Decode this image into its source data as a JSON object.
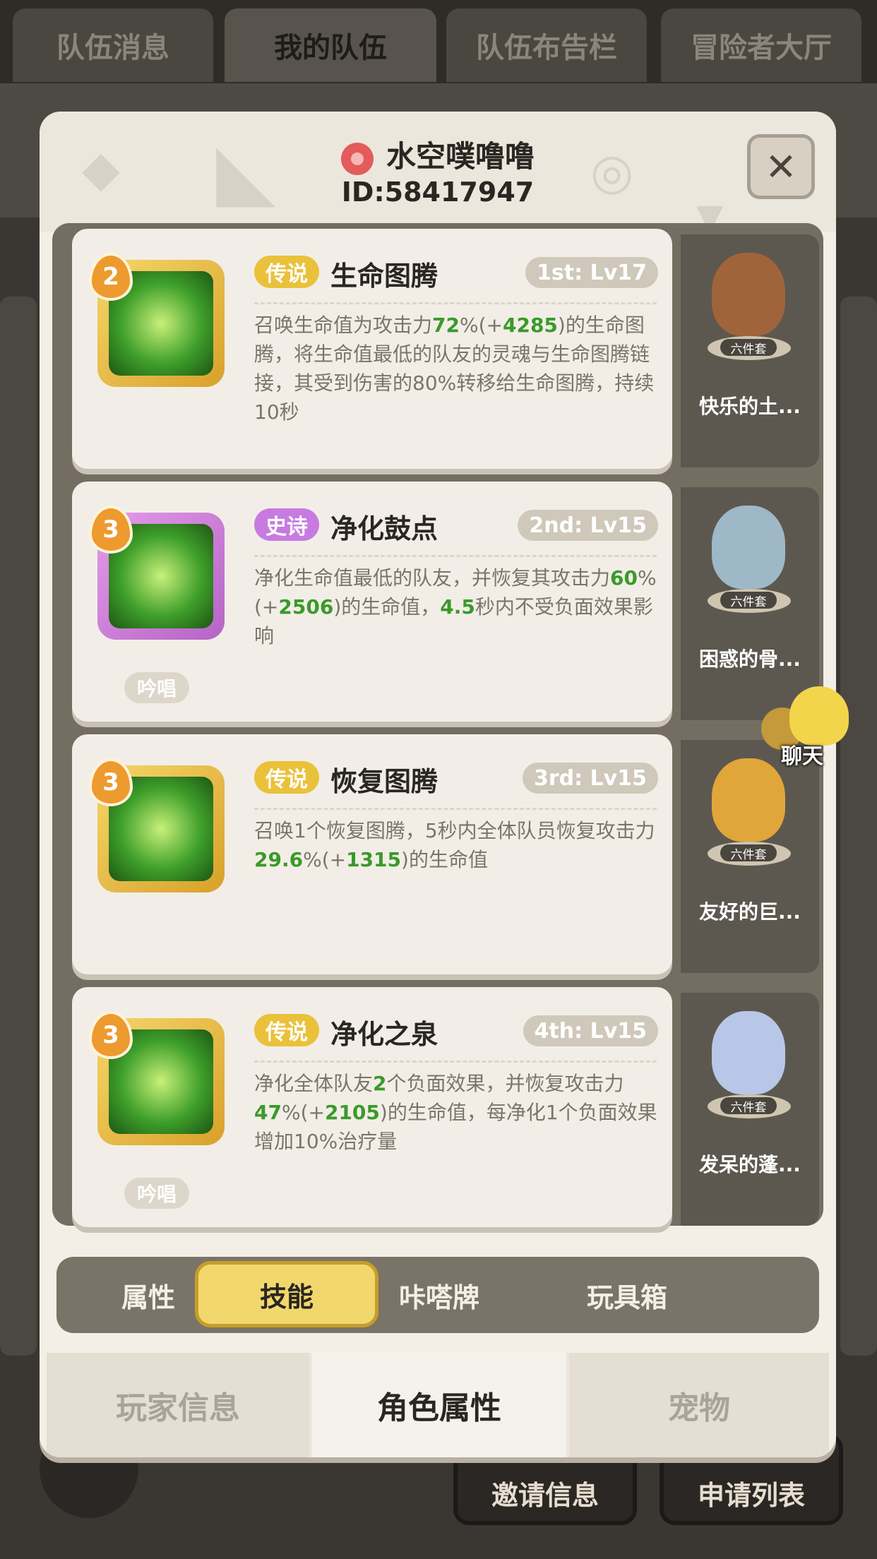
{
  "background": {
    "tabs": [
      "队伍消息",
      "我的队伍",
      "队伍布告栏",
      "冒险者大厅"
    ],
    "active_tab_index": 1,
    "bottom_buttons": [
      "邀请信息",
      "申请列表"
    ]
  },
  "player": {
    "name": "水空噗噜噜",
    "id_label": "ID:58417947"
  },
  "close_icon": "close-icon",
  "skills": [
    {
      "level_badge": "2",
      "rarity": "传说",
      "rarity_type": "legend",
      "name": "生命图腾",
      "rank": "1st: Lv17",
      "desc": [
        {
          "t": "召唤生命值为攻击力"
        },
        {
          "t": "72",
          "g": true
        },
        {
          "t": "%(+"
        },
        {
          "t": "4285",
          "g": true
        },
        {
          "t": ")的生命图腾，将生命值最低的队友的灵魂与生命图腾链接，其受到伤害的80%转移给生命图腾，持续10秒"
        }
      ],
      "chant": "",
      "pet_name": "快乐的土...",
      "pet_tag": "六件套",
      "pet_color": "#a0643a"
    },
    {
      "level_badge": "3",
      "rarity": "史诗",
      "rarity_type": "epic",
      "name": "净化鼓点",
      "rank": "2nd: Lv15",
      "desc": [
        {
          "t": "净化生命值最低的队友，并恢复其攻击力"
        },
        {
          "t": "60",
          "g": true
        },
        {
          "t": "%(+"
        },
        {
          "t": "2506",
          "g": true
        },
        {
          "t": ")的生命值，"
        },
        {
          "t": "4.5",
          "g": true
        },
        {
          "t": "秒内不受负面效果影响"
        }
      ],
      "chant": "吟唱",
      "pet_name": "困惑的骨...",
      "pet_tag": "六件套",
      "pet_color": "#9fb8c8"
    },
    {
      "level_badge": "3",
      "rarity": "传说",
      "rarity_type": "legend",
      "name": "恢复图腾",
      "rank": "3rd: Lv15",
      "desc": [
        {
          "t": "召唤1个恢复图腾，5秒内全体队员恢复攻击力"
        },
        {
          "t": "29.6",
          "g": true
        },
        {
          "t": "%(+"
        },
        {
          "t": "1315",
          "g": true
        },
        {
          "t": ")的生命值"
        }
      ],
      "chant": "",
      "pet_name": "友好的巨...",
      "pet_tag": "六件套",
      "pet_color": "#e0a63a"
    },
    {
      "level_badge": "3",
      "rarity": "传说",
      "rarity_type": "legend",
      "name": "净化之泉",
      "rank": "4th: Lv15",
      "desc": [
        {
          "t": "净化全体队友"
        },
        {
          "t": "2",
          "g": true
        },
        {
          "t": "个负面效果，并恢复攻击力"
        },
        {
          "t": "47",
          "g": true
        },
        {
          "t": "%(+"
        },
        {
          "t": "2105",
          "g": true
        },
        {
          "t": ")的生命值，每净化1个负面效果增加10%治疗量"
        }
      ],
      "chant": "吟唱",
      "pet_name": "发呆的蓬...",
      "pet_tag": "六件套",
      "pet_color": "#b8c7e8"
    }
  ],
  "chat": {
    "label": "聊天"
  },
  "sub_tabs": [
    "属性",
    "技能",
    "咔嗒牌",
    "玩具箱"
  ],
  "sub_tab_active": 1,
  "main_tabs": [
    "玩家信息",
    "角色属性",
    "宠物"
  ],
  "main_tab_active": 1,
  "colors": {
    "legend": "#eac13a",
    "epic": "#c77be0",
    "highlight_green": "#3a9a2a",
    "active_tab": "#f2d86c"
  }
}
